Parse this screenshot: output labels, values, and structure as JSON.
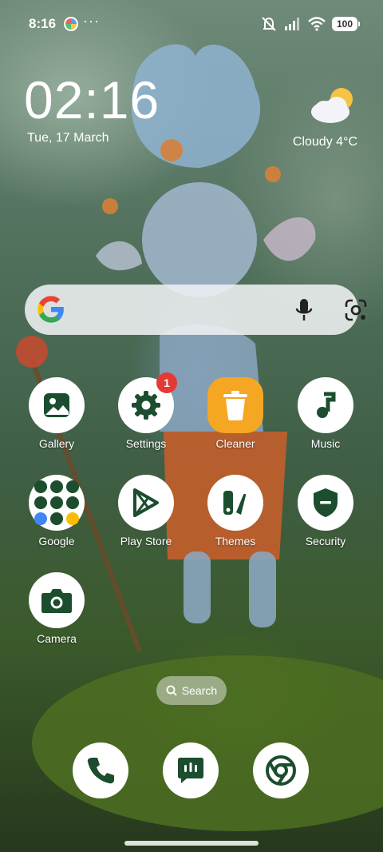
{
  "status_bar": {
    "time": "8:16",
    "app_icon": "app-notification-icon",
    "overflow": "···",
    "icons": [
      "mute-icon",
      "signal-icon",
      "wifi-icon",
      "battery-icon"
    ],
    "battery": "100"
  },
  "clock_widget": {
    "time": "02:16",
    "date": "Tue, 17 March"
  },
  "weather_widget": {
    "icon": "cloudy-sun-icon",
    "text": "Cloudy  4°C"
  },
  "search_widget": {
    "logo": "google-g-icon",
    "voice": "mic-icon",
    "lens": "lens-icon"
  },
  "apps": [
    {
      "name": "gallery",
      "label": "Gallery",
      "icon": "gallery-icon"
    },
    {
      "name": "settings",
      "label": "Settings",
      "icon": "gear-icon",
      "badge": "1"
    },
    {
      "name": "cleaner",
      "label": "Cleaner",
      "icon": "trash-icon"
    },
    {
      "name": "music",
      "label": "Music",
      "icon": "music-note-icon"
    },
    {
      "name": "google",
      "label": "Google",
      "icon": "folder-icon"
    },
    {
      "name": "play-store",
      "label": "Play Store",
      "icon": "play-store-icon"
    },
    {
      "name": "themes",
      "label": "Themes",
      "icon": "themes-icon"
    },
    {
      "name": "security",
      "label": "Security",
      "icon": "shield-icon"
    },
    {
      "name": "camera",
      "label": "Camera",
      "icon": "camera-icon"
    }
  ],
  "search_pill": {
    "label": "Search",
    "icon": "search-icon"
  },
  "dock": [
    {
      "name": "phone",
      "icon": "phone-icon"
    },
    {
      "name": "messages",
      "icon": "message-icon"
    },
    {
      "name": "chrome",
      "icon": "chrome-icon"
    }
  ],
  "colors": {
    "icon_dark_green": "#1b4d2e",
    "cleaner_orange": "#f5a623",
    "badge_red": "#e53935",
    "widget_bg": "#eef1f2"
  }
}
